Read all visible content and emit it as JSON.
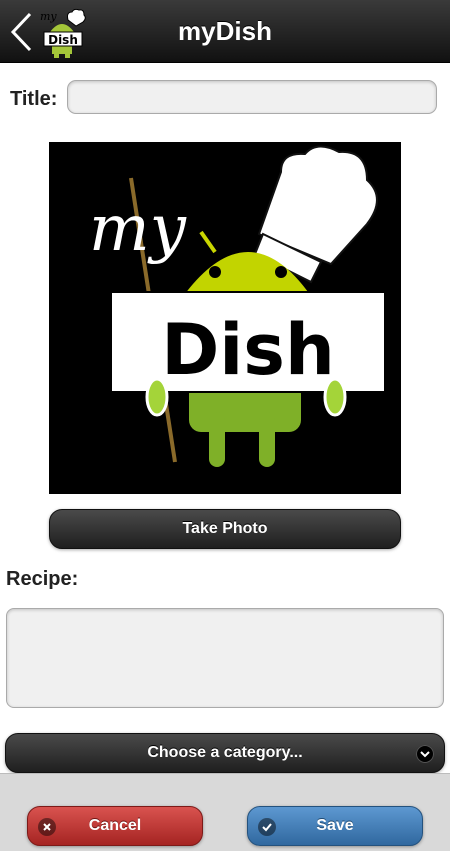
{
  "header": {
    "title": "myDish",
    "logo_text_top": "my",
    "logo_text_bottom": "Dish"
  },
  "form": {
    "title_label": "Title:",
    "title_value": "",
    "title_placeholder": "",
    "take_photo_label": "Take Photo",
    "recipe_label": "Recipe:",
    "recipe_value": "",
    "category_label": "Choose a category..."
  },
  "dish_image": {
    "text_top": "my",
    "text_bottom": "Dish"
  },
  "footer": {
    "cancel_label": "Cancel",
    "save_label": "Save"
  },
  "colors": {
    "header_bg": "#1a1a1a",
    "cancel": "#c0302c",
    "save": "#3f7bb8",
    "android_green": "#a4c639"
  },
  "icons": {
    "back": "chevron-left-icon",
    "category_chevron": "chevron-down-icon",
    "cancel": "close-icon",
    "save": "check-icon"
  }
}
